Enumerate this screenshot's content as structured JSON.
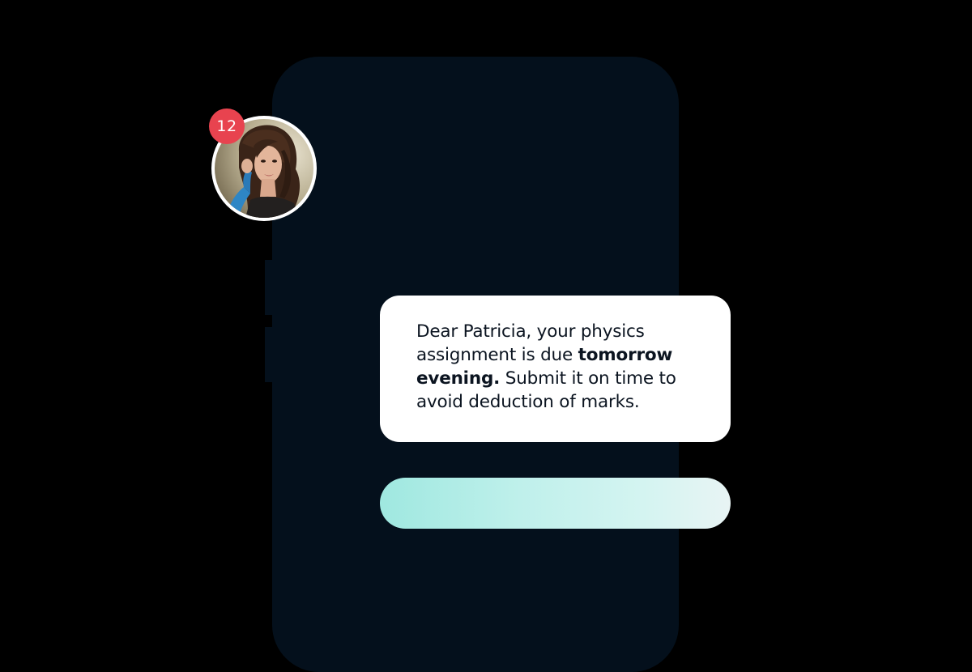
{
  "notification": {
    "badge_count": "12"
  },
  "message": {
    "before": "Dear Patricia, your physics assignment is due ",
    "bold": "tomorrow evening.",
    "after": " Submit it on time to avoid deduction of marks."
  },
  "colors": {
    "background": "#000000",
    "phone_body": "#04101c",
    "badge": "#e8434f",
    "card": "#ffffff",
    "input_gradient_start": "#9fe8e0",
    "input_gradient_end": "#e8f4f4"
  },
  "icons": {
    "avatar": "user-avatar-photo"
  }
}
